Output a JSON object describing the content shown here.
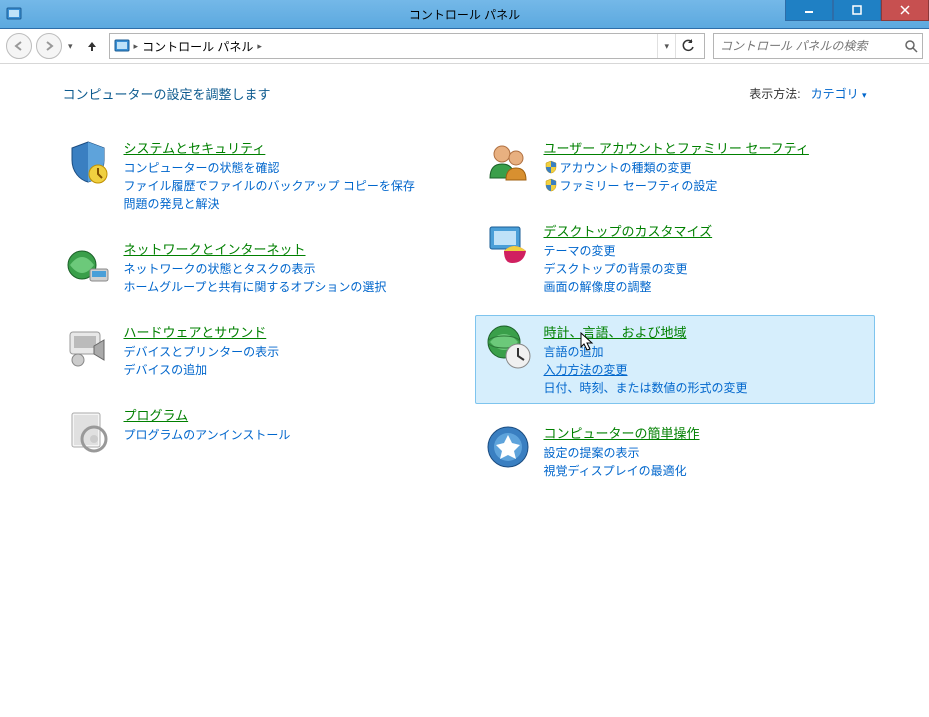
{
  "window": {
    "title": "コントロール パネル"
  },
  "nav": {
    "breadcrumb": "コントロール パネル",
    "search_placeholder": "コントロール パネルの検索"
  },
  "header": {
    "page_title": "コンピューターの設定を調整します",
    "view_by_label": "表示方法:",
    "view_by_value": "カテゴリ"
  },
  "categories": {
    "left": [
      {
        "title": "システムとセキュリティ",
        "links": [
          "コンピューターの状態を確認",
          "ファイル履歴でファイルのバックアップ コピーを保存",
          "問題の発見と解決"
        ]
      },
      {
        "title": "ネットワークとインターネット",
        "links": [
          "ネットワークの状態とタスクの表示",
          "ホームグループと共有に関するオプションの選択"
        ]
      },
      {
        "title": "ハードウェアとサウンド",
        "links": [
          "デバイスとプリンターの表示",
          "デバイスの追加"
        ]
      },
      {
        "title": "プログラム",
        "links": [
          "プログラムのアンインストール"
        ]
      }
    ],
    "right": [
      {
        "title": "ユーザー アカウントとファミリー セーフティ",
        "links": [
          "アカウントの種類の変更",
          "ファミリー セーフティの設定"
        ],
        "shields": [
          true,
          true
        ]
      },
      {
        "title": "デスクトップのカスタマイズ",
        "links": [
          "テーマの変更",
          "デスクトップの背景の変更",
          "画面の解像度の調整"
        ]
      },
      {
        "title": "時計、言語、および地域",
        "links": [
          "言語の追加",
          "入力方法の変更",
          "日付、時刻、または数値の形式の変更"
        ],
        "hover": true,
        "underline_index": 1
      },
      {
        "title": "コンピューターの簡単操作",
        "links": [
          "設定の提案の表示",
          "視覚ディスプレイの最適化"
        ]
      }
    ]
  }
}
